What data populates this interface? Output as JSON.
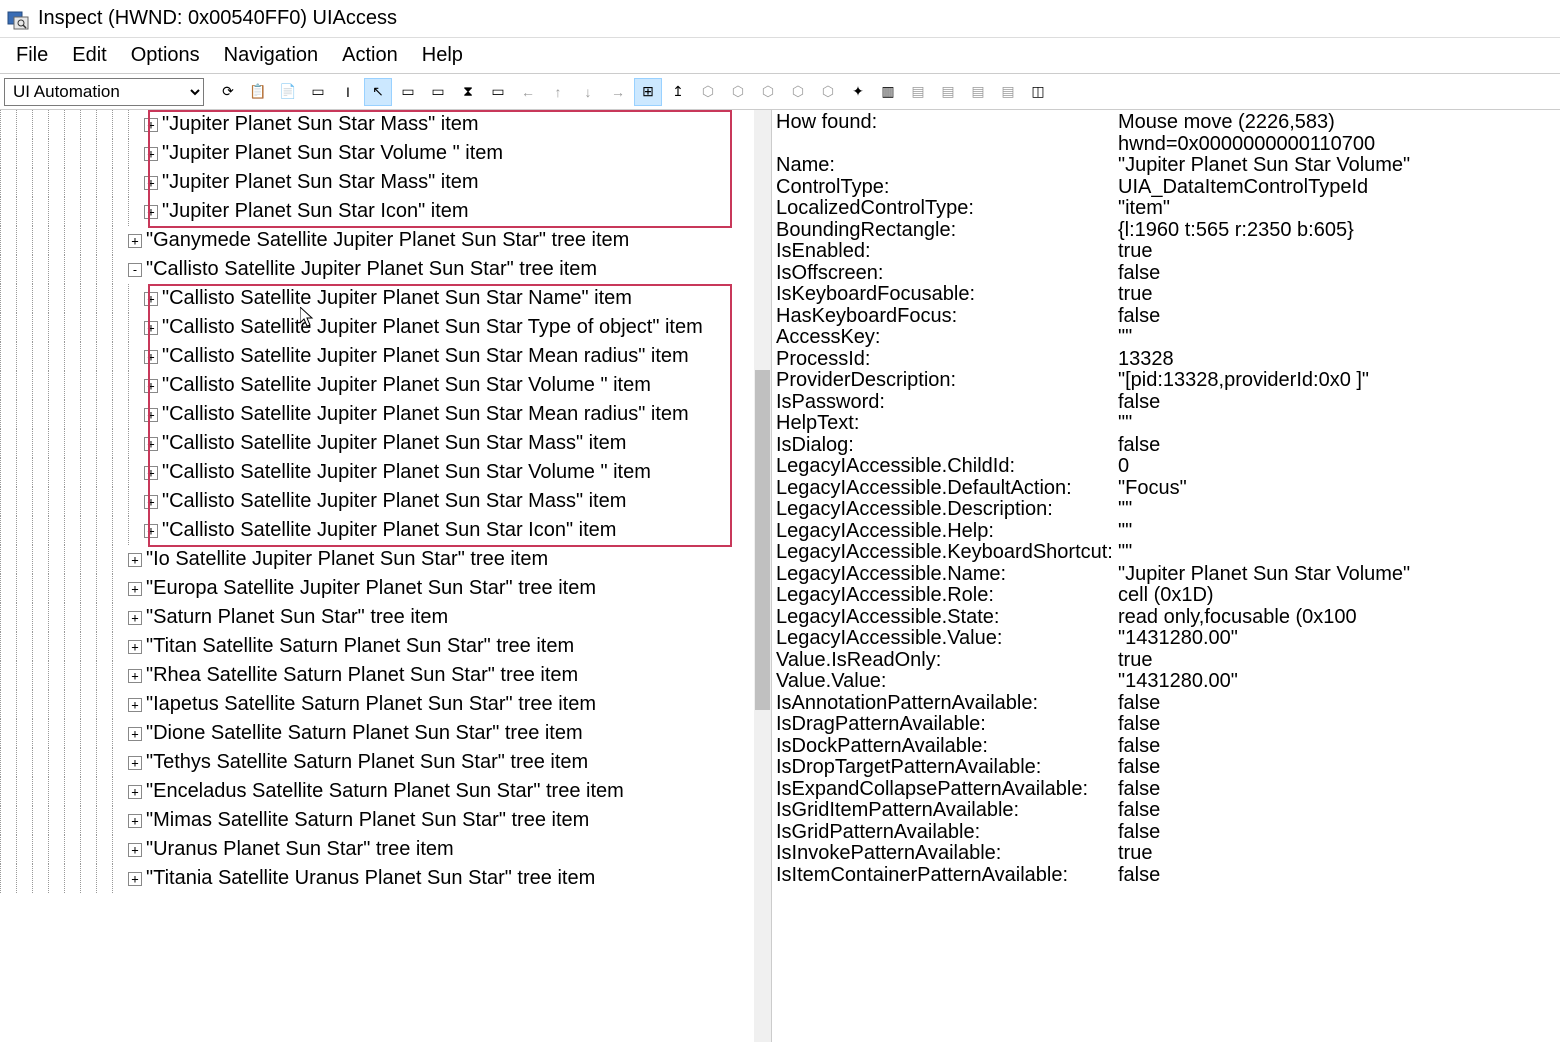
{
  "window": {
    "title": "Inspect  (HWND: 0x00540FF0) UIAccess"
  },
  "menu": [
    "File",
    "Edit",
    "Options",
    "Navigation",
    "Action",
    "Help"
  ],
  "mode": "UI Automation",
  "toolbar_icons": [
    {
      "name": "refresh-icon",
      "glyph": "⟳"
    },
    {
      "name": "copy-icon",
      "glyph": "📋"
    },
    {
      "name": "options-icon",
      "glyph": "📄"
    },
    {
      "name": "rectangle-icon",
      "glyph": "▭"
    },
    {
      "name": "caret-icon",
      "glyph": "I"
    },
    {
      "name": "cursor-icon",
      "glyph": "↖",
      "active": true
    },
    {
      "name": "tooltip-icon",
      "glyph": "▭"
    },
    {
      "name": "highlight-icon",
      "glyph": "▭"
    },
    {
      "name": "timer-icon",
      "glyph": "⧗"
    },
    {
      "name": "highlight2-icon",
      "glyph": "▭"
    },
    {
      "name": "nav-back-icon",
      "glyph": "←",
      "disabled": true
    },
    {
      "name": "nav-up-icon",
      "glyph": "↑",
      "disabled": true
    },
    {
      "name": "nav-down-icon",
      "glyph": "↓",
      "disabled": true
    },
    {
      "name": "nav-fwd-icon",
      "glyph": "→",
      "disabled": true
    },
    {
      "name": "tree-icon",
      "glyph": "⊞",
      "active": true
    },
    {
      "name": "parent-icon",
      "glyph": "↥"
    },
    {
      "name": "first-child-icon",
      "glyph": "⬡",
      "disabled": true
    },
    {
      "name": "next-sibling-icon",
      "glyph": "⬡",
      "disabled": true
    },
    {
      "name": "prev-sibling-icon",
      "glyph": "⬡",
      "disabled": true
    },
    {
      "name": "last-child-icon",
      "glyph": "⬡",
      "disabled": true
    },
    {
      "name": "ancestor-icon",
      "glyph": "⬡",
      "disabled": true
    },
    {
      "name": "focus-icon",
      "glyph": "✦"
    },
    {
      "name": "watch-icon",
      "glyph": "▥"
    },
    {
      "name": "misc1-icon",
      "glyph": "▤",
      "disabled": true
    },
    {
      "name": "misc2-icon",
      "glyph": "▤",
      "disabled": true
    },
    {
      "name": "misc3-icon",
      "glyph": "▤",
      "disabled": true
    },
    {
      "name": "misc4-icon",
      "glyph": "▤",
      "disabled": true
    },
    {
      "name": "window-icon",
      "glyph": "◫"
    }
  ],
  "tree": [
    {
      "indent": 9,
      "exp": "+",
      "label": "\"Jupiter Planet Sun Star Mass\" item"
    },
    {
      "indent": 9,
      "exp": "+",
      "label": "\"Jupiter Planet Sun Star Volume \" item"
    },
    {
      "indent": 9,
      "exp": "+",
      "label": "\"Jupiter Planet Sun Star Mass\" item"
    },
    {
      "indent": 9,
      "exp": "+",
      "label": "\"Jupiter Planet Sun Star Icon\" item"
    },
    {
      "indent": 8,
      "exp": "+",
      "label": "\"Ganymede Satellite Jupiter Planet Sun Star\" tree item"
    },
    {
      "indent": 8,
      "exp": "-",
      "label": "\"Callisto Satellite Jupiter Planet Sun Star\" tree item"
    },
    {
      "indent": 9,
      "exp": "+",
      "label": "\"Callisto Satellite Jupiter Planet Sun Star Name\" item"
    },
    {
      "indent": 9,
      "exp": "+",
      "label": "\"Callisto Satellite Jupiter Planet Sun Star Type of object\" item"
    },
    {
      "indent": 9,
      "exp": "+",
      "label": "\"Callisto Satellite Jupiter Planet Sun Star Mean radius\" item"
    },
    {
      "indent": 9,
      "exp": "+",
      "label": "\"Callisto Satellite Jupiter Planet Sun Star Volume \" item"
    },
    {
      "indent": 9,
      "exp": "+",
      "label": "\"Callisto Satellite Jupiter Planet Sun Star Mean radius\" item"
    },
    {
      "indent": 9,
      "exp": "+",
      "label": "\"Callisto Satellite Jupiter Planet Sun Star Mass\" item"
    },
    {
      "indent": 9,
      "exp": "+",
      "label": "\"Callisto Satellite Jupiter Planet Sun Star Volume \" item"
    },
    {
      "indent": 9,
      "exp": "+",
      "label": "\"Callisto Satellite Jupiter Planet Sun Star Mass\" item"
    },
    {
      "indent": 9,
      "exp": "+",
      "label": "\"Callisto Satellite Jupiter Planet Sun Star Icon\" item"
    },
    {
      "indent": 8,
      "exp": "+",
      "label": "\"Io Satellite Jupiter Planet Sun Star\" tree item"
    },
    {
      "indent": 8,
      "exp": "+",
      "label": "\"Europa Satellite Jupiter Planet Sun Star\" tree item"
    },
    {
      "indent": 8,
      "exp": "+",
      "label": "\"Saturn Planet Sun Star\" tree item"
    },
    {
      "indent": 8,
      "exp": "+",
      "label": "\"Titan Satellite Saturn Planet Sun Star\" tree item"
    },
    {
      "indent": 8,
      "exp": "+",
      "label": "\"Rhea Satellite Saturn Planet Sun Star\" tree item"
    },
    {
      "indent": 8,
      "exp": "+",
      "label": "\"Iapetus Satellite Saturn Planet Sun Star\" tree item"
    },
    {
      "indent": 8,
      "exp": "+",
      "label": "\"Dione Satellite Saturn Planet Sun Star\" tree item"
    },
    {
      "indent": 8,
      "exp": "+",
      "label": "\"Tethys Satellite Saturn Planet Sun Star\" tree item"
    },
    {
      "indent": 8,
      "exp": "+",
      "label": "\"Enceladus Satellite Saturn Planet Sun Star\" tree item"
    },
    {
      "indent": 8,
      "exp": "+",
      "label": "\"Mimas Satellite Saturn Planet Sun Star\" tree item"
    },
    {
      "indent": 8,
      "exp": "+",
      "label": "\"Uranus Planet Sun Star\" tree item"
    },
    {
      "indent": 8,
      "exp": "+",
      "label": "\"Titania Satellite Uranus Planet Sun Star\" tree item"
    }
  ],
  "properties": [
    {
      "k": "How found:",
      "v": "Mouse move (2226,583)"
    },
    {
      "k": "",
      "v": "hwnd=0x0000000000110700"
    },
    {
      "k": "Name:",
      "v": "\"Jupiter Planet Sun Star Volume\""
    },
    {
      "k": "ControlType:",
      "v": "UIA_DataItemControlTypeId"
    },
    {
      "k": "LocalizedControlType:",
      "v": "\"item\""
    },
    {
      "k": "BoundingRectangle:",
      "v": "{l:1960 t:565 r:2350 b:605}"
    },
    {
      "k": "IsEnabled:",
      "v": "true"
    },
    {
      "k": "IsOffscreen:",
      "v": "false"
    },
    {
      "k": "IsKeyboardFocusable:",
      "v": "true"
    },
    {
      "k": "HasKeyboardFocus:",
      "v": "false"
    },
    {
      "k": "AccessKey:",
      "v": "\"\""
    },
    {
      "k": "ProcessId:",
      "v": "13328"
    },
    {
      "k": "ProviderDescription:",
      "v": "\"[pid:13328,providerId:0x0 ]\""
    },
    {
      "k": "IsPassword:",
      "v": "false"
    },
    {
      "k": "HelpText:",
      "v": "\"\""
    },
    {
      "k": "IsDialog:",
      "v": "false"
    },
    {
      "k": "LegacyIAccessible.ChildId:",
      "v": "0"
    },
    {
      "k": "LegacyIAccessible.DefaultAction:",
      "v": "\"Focus\""
    },
    {
      "k": "LegacyIAccessible.Description:",
      "v": "\"\""
    },
    {
      "k": "LegacyIAccessible.Help:",
      "v": "\"\""
    },
    {
      "k": "LegacyIAccessible.KeyboardShortcut:",
      "v": "\"\""
    },
    {
      "k": "LegacyIAccessible.Name:",
      "v": "\"Jupiter Planet Sun Star Volume\""
    },
    {
      "k": "LegacyIAccessible.Role:",
      "v": "cell (0x1D)"
    },
    {
      "k": "LegacyIAccessible.State:",
      "v": "read only,focusable (0x100"
    },
    {
      "k": "LegacyIAccessible.Value:",
      "v": "\"1431280.00\""
    },
    {
      "k": "Value.IsReadOnly:",
      "v": "true"
    },
    {
      "k": "Value.Value:",
      "v": "\"1431280.00\""
    },
    {
      "k": "IsAnnotationPatternAvailable:",
      "v": "false"
    },
    {
      "k": "IsDragPatternAvailable:",
      "v": "false"
    },
    {
      "k": "IsDockPatternAvailable:",
      "v": "false"
    },
    {
      "k": "IsDropTargetPatternAvailable:",
      "v": "false"
    },
    {
      "k": "IsExpandCollapsePatternAvailable:",
      "v": "false"
    },
    {
      "k": "IsGridItemPatternAvailable:",
      "v": "false"
    },
    {
      "k": "IsGridPatternAvailable:",
      "v": "false"
    },
    {
      "k": "IsInvokePatternAvailable:",
      "v": "true"
    },
    {
      "k": "IsItemContainerPatternAvailable:",
      "v": "false"
    }
  ]
}
